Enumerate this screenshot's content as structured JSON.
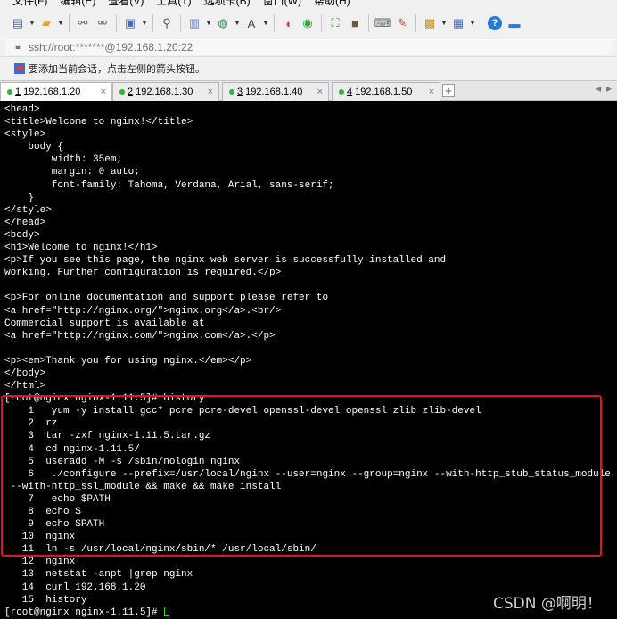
{
  "menu": {
    "items": [
      "文件(F)",
      "编辑(E)",
      "查看(V)",
      "工具(T)",
      "选项卡(B)",
      "窗口(W)",
      "帮助(H)"
    ]
  },
  "toolbar": {
    "buttons": [
      {
        "name": "new-session-icon",
        "glyph": "▤",
        "color": "#3a70c4",
        "dropdown": true
      },
      {
        "name": "open-folder-icon",
        "glyph": "▰",
        "color": "#e2a72e",
        "dropdown": true
      },
      {
        "name": "connect-icon",
        "glyph": "⚯",
        "color": "#666666",
        "dropdown": false
      },
      {
        "name": "disconnect-icon",
        "glyph": "⚮",
        "color": "#666666",
        "dropdown": false
      },
      {
        "name": "window-icon",
        "glyph": "▣",
        "color": "#4a6fb0",
        "dropdown": true
      },
      {
        "name": "search-icon",
        "glyph": "⚲",
        "color": "#555555",
        "dropdown": false
      },
      {
        "name": "properties-icon",
        "glyph": "▥",
        "color": "#5b8ad1",
        "dropdown": true
      },
      {
        "name": "globe-icon",
        "glyph": "◍",
        "color": "#2d8a4a",
        "dropdown": true
      },
      {
        "name": "font-icon",
        "glyph": "A",
        "color": "#444444",
        "dropdown": true
      },
      {
        "name": "xftp-icon",
        "glyph": "◖",
        "color": "#d93030",
        "dropdown": false
      },
      {
        "name": "xshell-green-icon",
        "glyph": "◉",
        "color": "#37a437",
        "dropdown": false
      },
      {
        "name": "resize-icon",
        "glyph": "⛶",
        "color": "#3a9b3a",
        "dropdown": false
      },
      {
        "name": "lock-icon",
        "glyph": "■",
        "color": "#6a5a3a",
        "dropdown": false
      },
      {
        "name": "keyboard-icon",
        "glyph": "⌨",
        "color": "#666666",
        "dropdown": false
      },
      {
        "name": "compose-icon",
        "glyph": "✎",
        "color": "#c24a2a",
        "dropdown": false
      },
      {
        "name": "script-icon",
        "glyph": "▩",
        "color": "#d08a22",
        "dropdown": true
      },
      {
        "name": "layout-icon",
        "glyph": "▦",
        "color": "#3a70c4",
        "dropdown": true
      },
      {
        "name": "help-icon",
        "glyph": "?",
        "color": "#2a7ad8",
        "dropdown": false
      },
      {
        "name": "chat-icon",
        "glyph": "▬",
        "color": "#2a7ad8",
        "dropdown": false
      }
    ]
  },
  "address": {
    "text": "ssh://root:*******@192.168.1.20:22"
  },
  "hint": {
    "text": "要添加当前会话，点击左侧的箭头按钮。"
  },
  "tabs": [
    {
      "num": "1",
      "label": "192.168.1.20",
      "active": true,
      "close": "×"
    },
    {
      "num": "2",
      "label": "192.168.1.30",
      "active": false,
      "close": "×"
    },
    {
      "num": "3",
      "label": "192.168.1.40",
      "active": false,
      "close": "×"
    },
    {
      "num": "4",
      "label": "192.168.1.50",
      "active": false,
      "close": "×"
    }
  ],
  "tab_add_label": "+",
  "terminal": {
    "lines": [
      "<head>",
      "<title>Welcome to nginx!</title>",
      "<style>",
      "    body {",
      "        width: 35em;",
      "        margin: 0 auto;",
      "        font-family: Tahoma, Verdana, Arial, sans-serif;",
      "    }",
      "</style>",
      "</head>",
      "<body>",
      "<h1>Welcome to nginx!</h1>",
      "<p>If you see this page, the nginx web server is successfully installed and",
      "working. Further configuration is required.</p>",
      "",
      "<p>For online documentation and support please refer to",
      "<a href=\"http://nginx.org/\">nginx.org</a>.<br/>",
      "Commercial support is available at",
      "<a href=\"http://nginx.com/\">nginx.com</a>.</p>",
      "",
      "<p><em>Thank you for using nginx.</em></p>",
      "</body>",
      "</html>",
      "[root@nginx nginx-1.11.5]# history",
      "    1   yum -y install gcc* pcre pcre-devel openssl-devel openssl zlib zlib-devel",
      "    2  rz",
      "    3  tar -zxf nginx-1.11.5.tar.gz",
      "    4  cd nginx-1.11.5/",
      "    5  useradd -M -s /sbin/nologin nginx",
      "    6   ./configure --prefix=/usr/local/nginx --user=nginx --group=nginx --with-http_stub_status_module",
      " --with-http_ssl_module && make && make install",
      "    7   echo $PATH",
      "    8  echo $",
      "    9  echo $PATH",
      "   10  nginx",
      "   11  ln -s /usr/local/nginx/sbin/* /usr/local/sbin/",
      "   12  nginx",
      "   13  netstat -anpt |grep nginx",
      "   14  curl 192.168.1.20",
      "   15  history"
    ],
    "prompt": "[root@nginx nginx-1.11.5]# "
  },
  "watermark": "CSDN @啊明！",
  "colors": {
    "terminal_bg": "#000000",
    "terminal_fg": "#ffffff",
    "highlight_border": "#e0141e",
    "active_dot": "#2fb52f"
  }
}
